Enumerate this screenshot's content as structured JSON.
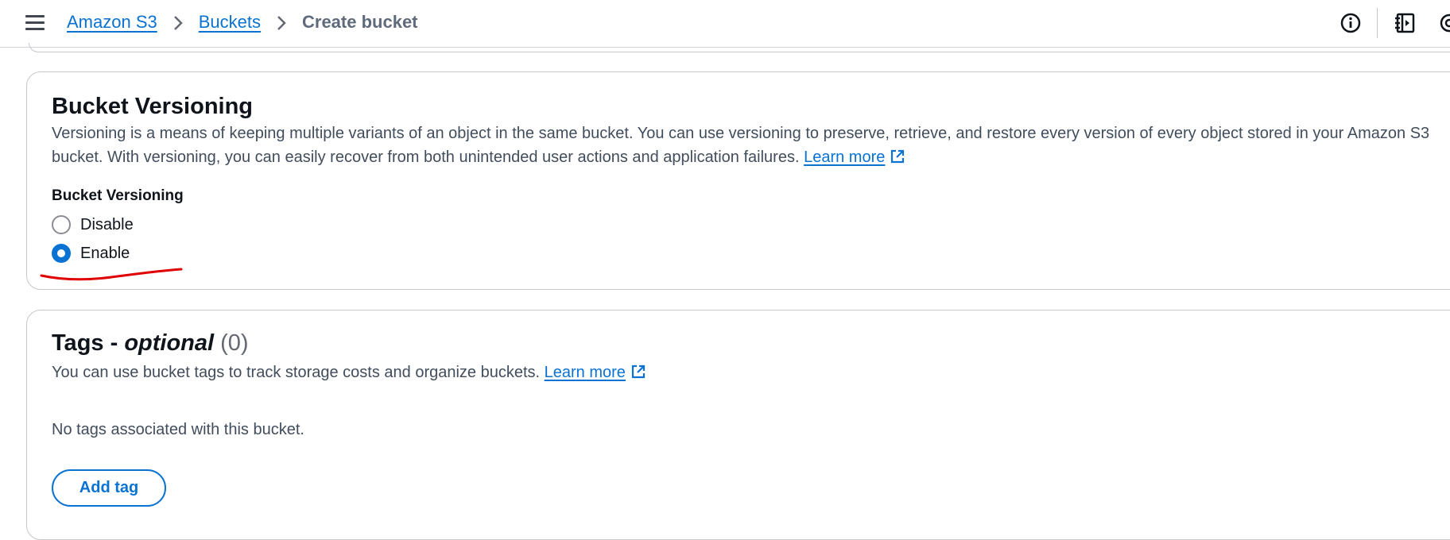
{
  "header": {
    "menu_icon": "hamburger-menu-icon",
    "breadcrumb": {
      "root": "Amazon S3",
      "parent": "Buckets",
      "current": "Create bucket"
    },
    "icons": [
      "info-icon",
      "side-panel-icon",
      "settings-icon"
    ]
  },
  "versioning": {
    "title": "Bucket Versioning",
    "description": "Versioning is a means of keeping multiple variants of an object in the same bucket. You can use versioning to preserve, retrieve, and restore every version of every object stored in your Amazon S3 bucket. With versioning, you can easily recover from both unintended user actions and application failures.",
    "learn_more": "Learn more",
    "field_label": "Bucket Versioning",
    "options": [
      {
        "label": "Disable",
        "selected": false
      },
      {
        "label": "Enable",
        "selected": true
      }
    ],
    "annotation_color": "#e00000"
  },
  "tags": {
    "title_main": "Tags -",
    "title_optional": "optional",
    "title_count": "(0)",
    "description": "You can use bucket tags to track storage costs and organize buckets.",
    "learn_more": "Learn more",
    "empty_text": "No tags associated with this bucket.",
    "add_button": "Add tag"
  },
  "colors": {
    "link": "#0972d3",
    "text": "#0f141a",
    "muted": "#414d5c"
  }
}
